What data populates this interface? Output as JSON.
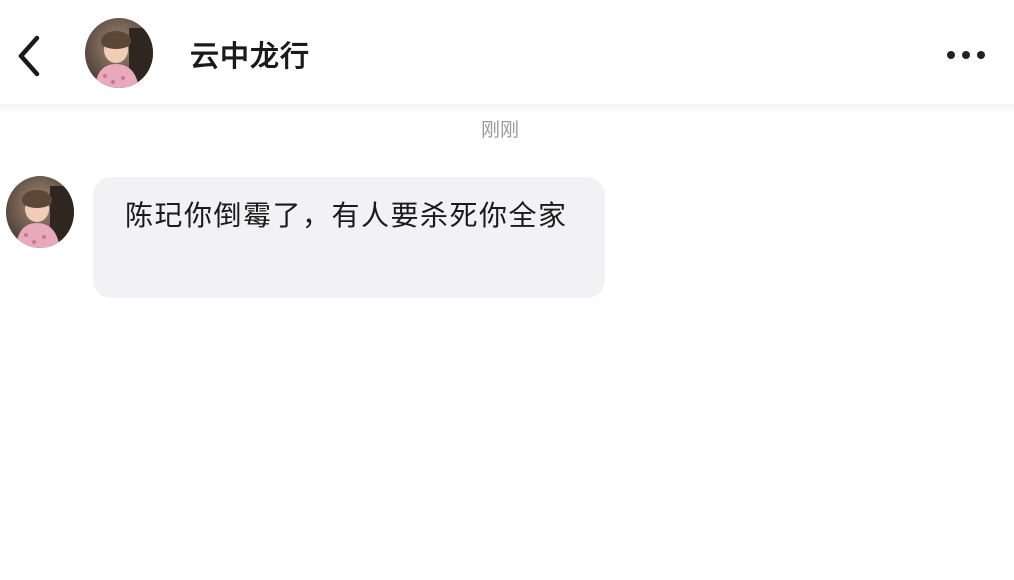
{
  "header": {
    "contact_name": "云中龙行",
    "back_icon": "chevron-left-icon",
    "more_icon": "more-horizontal-icon"
  },
  "chat": {
    "timestamp": "刚刚",
    "messages": [
      {
        "sender": "contact",
        "text": "陈玘你倒霉了，有人要杀死你全家"
      }
    ]
  },
  "colors": {
    "background": "#ffffff",
    "bubble": "#f2f2f4",
    "timestamp_text": "#9a9a9a",
    "primary_text": "#1a1a1a"
  }
}
